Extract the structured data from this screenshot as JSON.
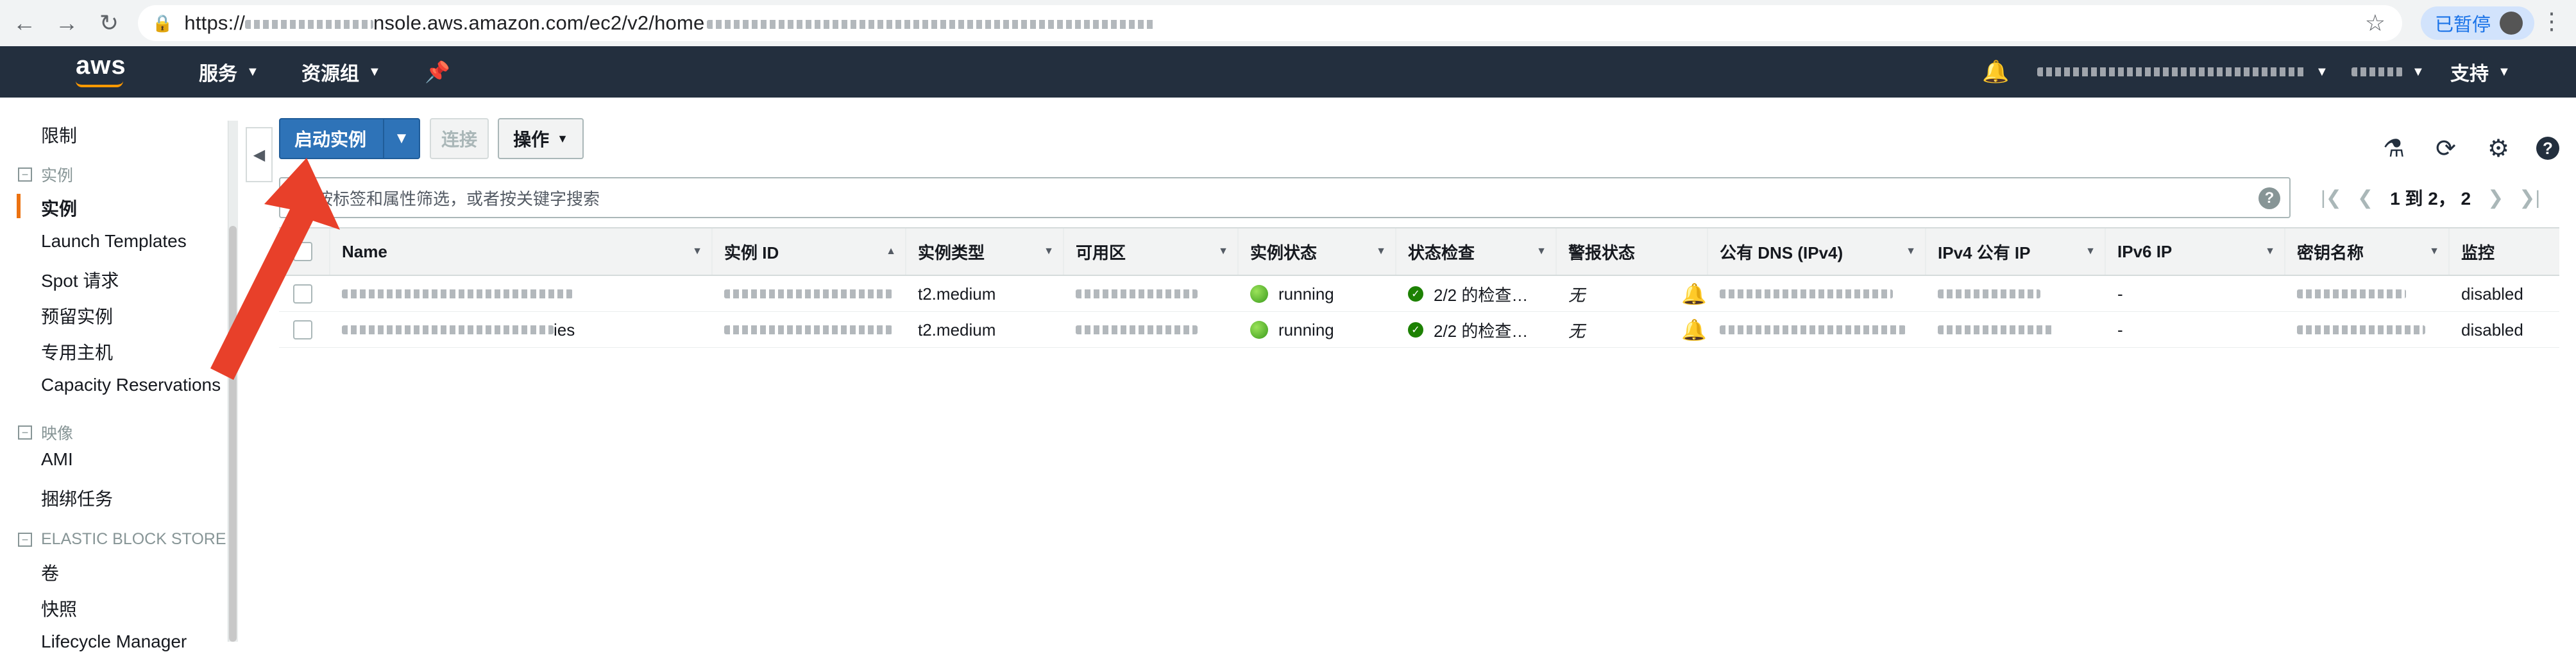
{
  "browser": {
    "url_prefix": "https://",
    "url_visible": "nsole.aws.amazon.com/ec2/v2/home",
    "paused_label": "已暂停"
  },
  "header": {
    "logo_text": "aws",
    "services_label": "服务",
    "resource_groups_label": "资源组",
    "support_label": "支持"
  },
  "sidebar": {
    "items": [
      {
        "label": "限制"
      },
      {
        "section": "实例"
      },
      {
        "label": "实例",
        "active": true
      },
      {
        "label": "Launch Templates"
      },
      {
        "label": "Spot 请求"
      },
      {
        "label": "预留实例"
      },
      {
        "label": "专用主机"
      },
      {
        "label": "Capacity Reservations"
      },
      {
        "section": "映像"
      },
      {
        "label": "AMI"
      },
      {
        "label": "捆绑任务"
      },
      {
        "section": "ELASTIC BLOCK STORE"
      },
      {
        "label": "卷"
      },
      {
        "label": "快照"
      },
      {
        "label": "Lifecycle Manager"
      }
    ]
  },
  "toolbar": {
    "launch_label": "启动实例",
    "connect_label": "连接",
    "actions_label": "操作"
  },
  "search": {
    "placeholder": "按标签和属性筛选，或者按关键字搜索"
  },
  "pager": {
    "text": "1 到 2，  2"
  },
  "table": {
    "columns": [
      "Name",
      "实例 ID",
      "实例类型",
      "可用区",
      "实例状态",
      "状态检查",
      "警报状态",
      "公有 DNS (IPv4)",
      "IPv4 公有 IP",
      "IPv6 IP",
      "密钥名称",
      "监控"
    ],
    "rows": [
      {
        "name_suffix": "",
        "type": "t2.medium",
        "state": "running",
        "checks": "2/2 的检查…",
        "alarm": "无",
        "ipv6": "-",
        "monitoring": "disabled"
      },
      {
        "name_suffix": "ies",
        "type": "t2.medium",
        "state": "running",
        "checks": "2/2 的检查…",
        "alarm": "无",
        "ipv6": "-",
        "monitoring": "disabled"
      }
    ]
  },
  "colors": {
    "aws_header": "#232f3e",
    "primary_button": "#2e73b8",
    "active_bar": "#ec7211",
    "arrow": "#e8402a"
  }
}
